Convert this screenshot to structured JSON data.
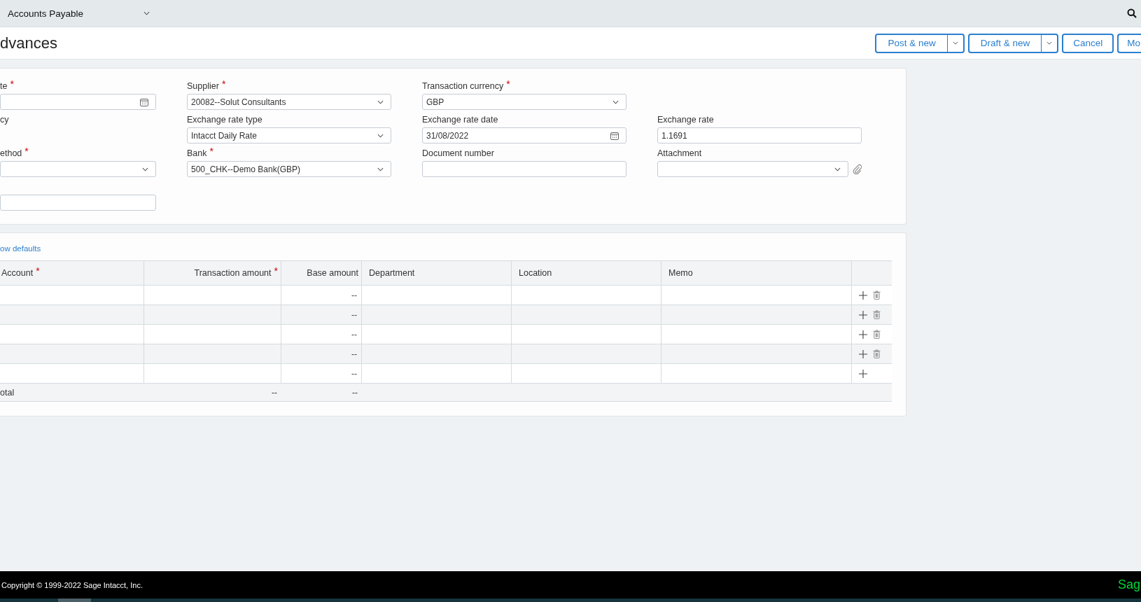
{
  "top_bar": {
    "module": "Accounts Payable"
  },
  "header": {
    "title": "dvances",
    "buttons": [
      {
        "label": "Post & new",
        "kind": "split"
      },
      {
        "label": "Draft & new",
        "kind": "split"
      },
      {
        "label": "Cancel",
        "kind": "plain"
      },
      {
        "label": "Mo",
        "kind": "cut"
      }
    ]
  },
  "form": {
    "rows": [
      [
        {
          "label": "te",
          "required": "*",
          "kind": "date"
        },
        {
          "label": "Supplier",
          "required": "*",
          "kind": "select",
          "value": "20082--Solut Consultants"
        },
        {
          "label": "Transaction currency",
          "required": "*",
          "kind": "select",
          "value": "GBP"
        }
      ],
      [
        {
          "label": "cy",
          "kind": "label"
        },
        {
          "label": "Exchange rate type",
          "kind": "select",
          "value": "Intacct Daily Rate"
        },
        {
          "label": "Exchange rate date",
          "kind": "date",
          "value": "31/08/2022"
        },
        {
          "label": "Exchange rate",
          "kind": "text",
          "value": "1.1691"
        }
      ],
      [
        {
          "label": "ethod",
          "required": "*",
          "kind": "select"
        },
        {
          "label": "Bank",
          "required": "*",
          "kind": "select",
          "value": "500_CHK--Demo Bank(GBP)"
        },
        {
          "label": "Document number",
          "kind": "text"
        },
        {
          "label": "Attachment",
          "kind": "attachment"
        }
      ],
      [
        {
          "kind": "text"
        }
      ]
    ]
  },
  "lines": {
    "link": "ow defaults",
    "columns": [
      {
        "label": "Account",
        "required": "*",
        "kind": "text"
      },
      {
        "label": "Transaction amount",
        "required": "*",
        "kind": "amount"
      },
      {
        "label": "Base amount",
        "kind": "amount"
      },
      {
        "label": "Department",
        "kind": "text"
      },
      {
        "label": "Location",
        "kind": "text"
      },
      {
        "label": "Memo",
        "kind": "text"
      }
    ],
    "rows": [
      {
        "base_amount": "--",
        "deletable": true
      },
      {
        "base_amount": "--",
        "deletable": true
      },
      {
        "base_amount": "--",
        "deletable": true
      },
      {
        "base_amount": "--",
        "deletable": true
      },
      {
        "base_amount": "--",
        "deletable": false
      }
    ],
    "total": {
      "label": "otal",
      "transaction_amount": "--",
      "base_amount": "--"
    }
  },
  "footer": {
    "copyright": "Copyright © 1999-2022 Sage Intacct, Inc.",
    "logo": "Sag"
  }
}
